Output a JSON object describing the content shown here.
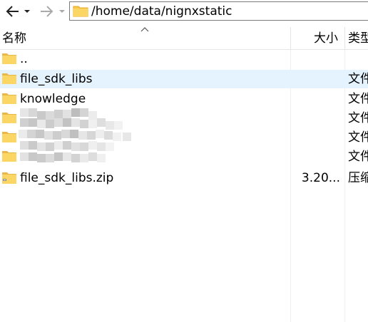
{
  "toolbar": {
    "back_icon": "arrow-left-icon",
    "dropdown_icon": "chevron-down-icon",
    "forward_icon": "arrow-right-icon",
    "path": "/home/data/nignxstatic"
  },
  "columns": {
    "name": "名称",
    "size": "大小",
    "type": "类型"
  },
  "rows": [
    {
      "name": "..",
      "size": "",
      "type": "",
      "icon": "folder-icon"
    },
    {
      "name": "file_sdk_libs",
      "size": "",
      "type": "文件",
      "icon": "folder-icon"
    },
    {
      "name": "knowledge",
      "size": "",
      "type": "文件",
      "icon": "folder-icon"
    },
    {
      "name": "",
      "size": "",
      "type": "文件",
      "icon": "folder-icon"
    },
    {
      "name": "",
      "size": "",
      "type": "文件",
      "icon": "folder-icon"
    },
    {
      "name": "",
      "size": "",
      "type": "文件",
      "icon": "folder-icon"
    },
    {
      "name": "file_sdk_libs.zip",
      "size": "3.20...",
      "type": "压缩",
      "icon": "zip-icon"
    }
  ],
  "colors": {
    "selected_row": "#e5f3ff",
    "folder_yellow": "#f8c94a"
  }
}
